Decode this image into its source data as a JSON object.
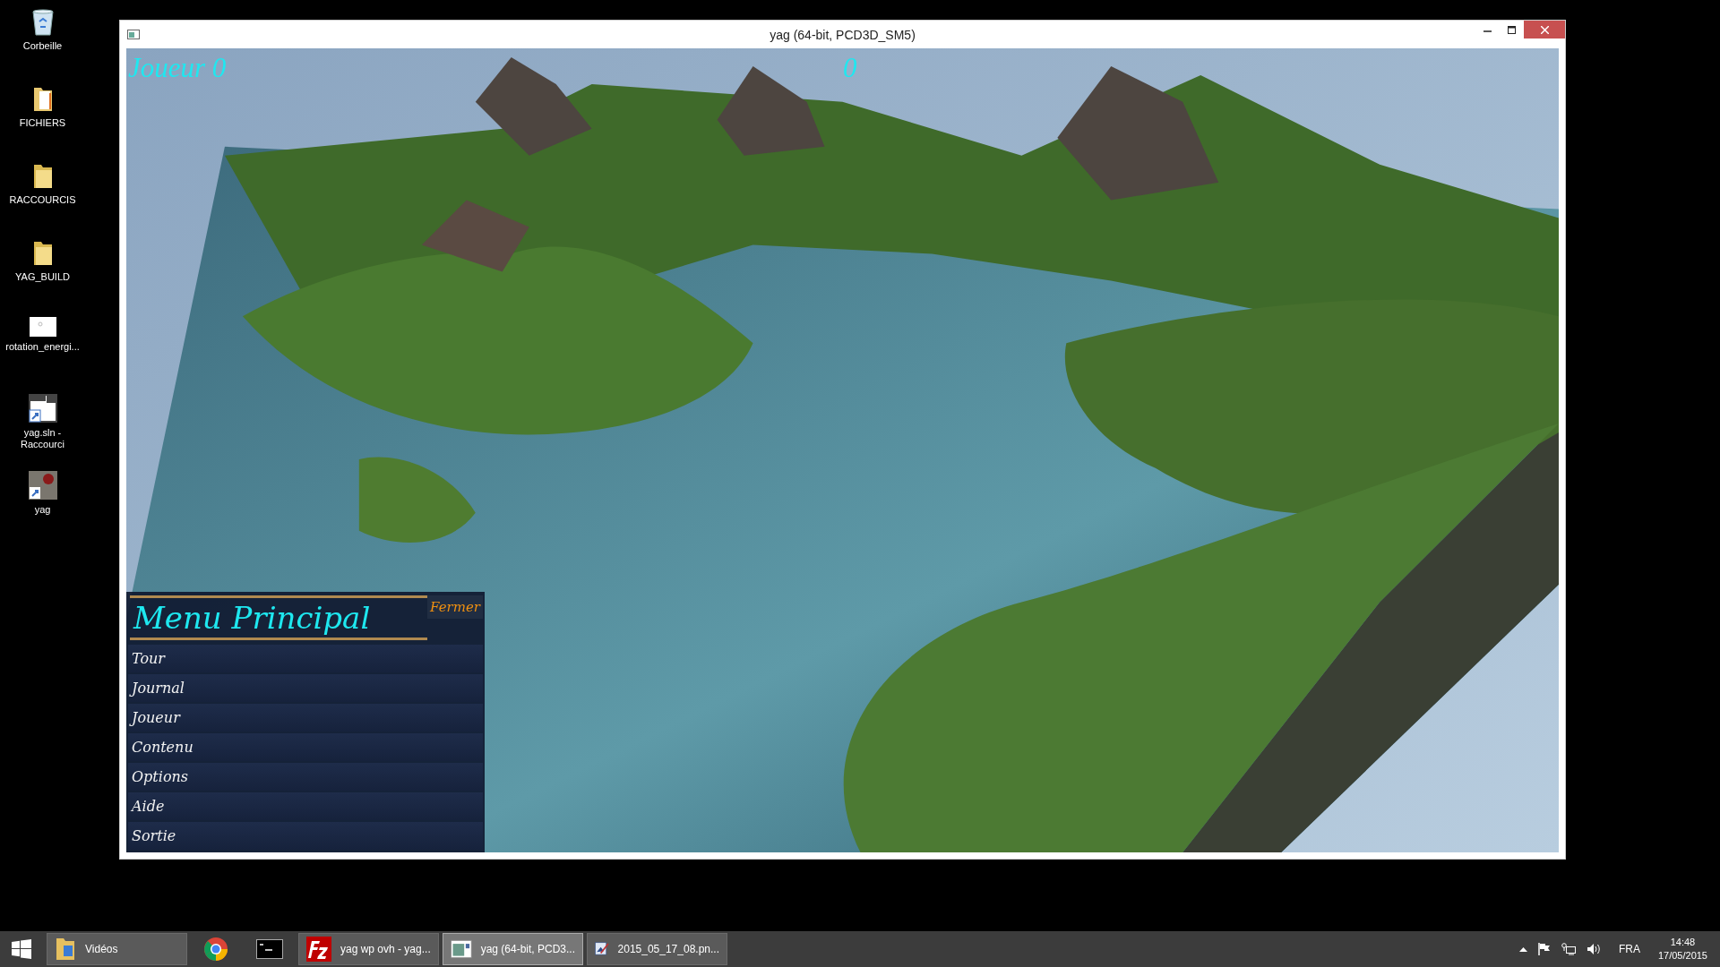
{
  "desktop_icons": [
    {
      "label": "Corbeille",
      "kind": "trash"
    },
    {
      "label": "FICHIERS",
      "kind": "folder-docs"
    },
    {
      "label": "RACCOURCIS",
      "kind": "folder"
    },
    {
      "label": "YAG_BUILD",
      "kind": "folder"
    },
    {
      "label": "rotation_energi...",
      "kind": "image"
    },
    {
      "label": "yag.sln -\nRaccourci",
      "kind": "solution"
    },
    {
      "label": "yag",
      "kind": "app"
    }
  ],
  "window": {
    "title": "yag (64-bit, PCD3D_SM5)",
    "hud": {
      "player": "Joueur 0",
      "score": "0"
    },
    "menu": {
      "title": "Menu Principal",
      "close": "Fermer",
      "items": [
        "Tour",
        "Journal",
        "Joueur",
        "Contenu",
        "Options",
        "Aide",
        "Sortie"
      ]
    }
  },
  "taskbar": {
    "items": [
      {
        "label": "Vidéos",
        "kind": "folder",
        "selected": false
      },
      {
        "kind": "browser",
        "selected": false
      },
      {
        "kind": "console",
        "selected": false
      },
      {
        "label": "yag wp ovh - yag...",
        "kind": "ftp",
        "selected": false
      },
      {
        "label": "yag (64-bit, PCD3...",
        "kind": "window",
        "selected": true
      },
      {
        "label": "2015_05_17_08.pn...",
        "kind": "paint",
        "selected": false
      }
    ],
    "tray": {
      "language": "FRA",
      "time": "14:48",
      "date": "17/05/2015"
    }
  }
}
